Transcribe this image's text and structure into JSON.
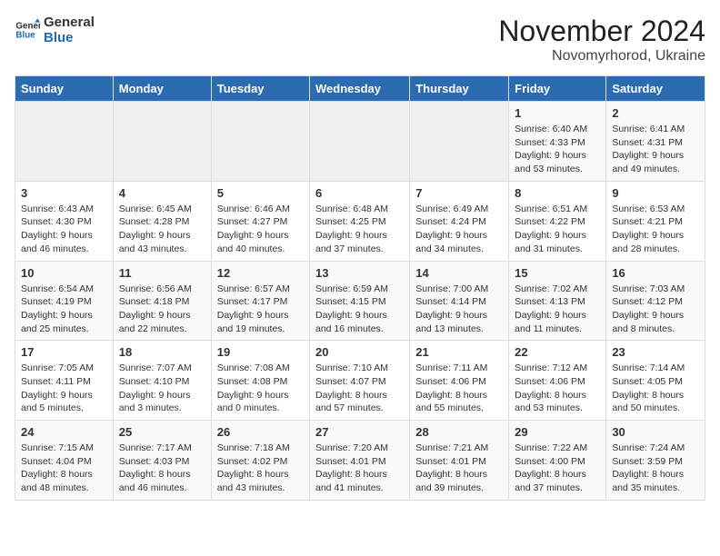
{
  "logo": {
    "line1": "General",
    "line2": "Blue"
  },
  "title": "November 2024",
  "location": "Novomyrhorod, Ukraine",
  "days_header": [
    "Sunday",
    "Monday",
    "Tuesday",
    "Wednesday",
    "Thursday",
    "Friday",
    "Saturday"
  ],
  "weeks": [
    [
      {
        "day": "",
        "info": ""
      },
      {
        "day": "",
        "info": ""
      },
      {
        "day": "",
        "info": ""
      },
      {
        "day": "",
        "info": ""
      },
      {
        "day": "",
        "info": ""
      },
      {
        "day": "1",
        "info": "Sunrise: 6:40 AM\nSunset: 4:33 PM\nDaylight: 9 hours and 53 minutes."
      },
      {
        "day": "2",
        "info": "Sunrise: 6:41 AM\nSunset: 4:31 PM\nDaylight: 9 hours and 49 minutes."
      }
    ],
    [
      {
        "day": "3",
        "info": "Sunrise: 6:43 AM\nSunset: 4:30 PM\nDaylight: 9 hours and 46 minutes."
      },
      {
        "day": "4",
        "info": "Sunrise: 6:45 AM\nSunset: 4:28 PM\nDaylight: 9 hours and 43 minutes."
      },
      {
        "day": "5",
        "info": "Sunrise: 6:46 AM\nSunset: 4:27 PM\nDaylight: 9 hours and 40 minutes."
      },
      {
        "day": "6",
        "info": "Sunrise: 6:48 AM\nSunset: 4:25 PM\nDaylight: 9 hours and 37 minutes."
      },
      {
        "day": "7",
        "info": "Sunrise: 6:49 AM\nSunset: 4:24 PM\nDaylight: 9 hours and 34 minutes."
      },
      {
        "day": "8",
        "info": "Sunrise: 6:51 AM\nSunset: 4:22 PM\nDaylight: 9 hours and 31 minutes."
      },
      {
        "day": "9",
        "info": "Sunrise: 6:53 AM\nSunset: 4:21 PM\nDaylight: 9 hours and 28 minutes."
      }
    ],
    [
      {
        "day": "10",
        "info": "Sunrise: 6:54 AM\nSunset: 4:19 PM\nDaylight: 9 hours and 25 minutes."
      },
      {
        "day": "11",
        "info": "Sunrise: 6:56 AM\nSunset: 4:18 PM\nDaylight: 9 hours and 22 minutes."
      },
      {
        "day": "12",
        "info": "Sunrise: 6:57 AM\nSunset: 4:17 PM\nDaylight: 9 hours and 19 minutes."
      },
      {
        "day": "13",
        "info": "Sunrise: 6:59 AM\nSunset: 4:15 PM\nDaylight: 9 hours and 16 minutes."
      },
      {
        "day": "14",
        "info": "Sunrise: 7:00 AM\nSunset: 4:14 PM\nDaylight: 9 hours and 13 minutes."
      },
      {
        "day": "15",
        "info": "Sunrise: 7:02 AM\nSunset: 4:13 PM\nDaylight: 9 hours and 11 minutes."
      },
      {
        "day": "16",
        "info": "Sunrise: 7:03 AM\nSunset: 4:12 PM\nDaylight: 9 hours and 8 minutes."
      }
    ],
    [
      {
        "day": "17",
        "info": "Sunrise: 7:05 AM\nSunset: 4:11 PM\nDaylight: 9 hours and 5 minutes."
      },
      {
        "day": "18",
        "info": "Sunrise: 7:07 AM\nSunset: 4:10 PM\nDaylight: 9 hours and 3 minutes."
      },
      {
        "day": "19",
        "info": "Sunrise: 7:08 AM\nSunset: 4:08 PM\nDaylight: 9 hours and 0 minutes."
      },
      {
        "day": "20",
        "info": "Sunrise: 7:10 AM\nSunset: 4:07 PM\nDaylight: 8 hours and 57 minutes."
      },
      {
        "day": "21",
        "info": "Sunrise: 7:11 AM\nSunset: 4:06 PM\nDaylight: 8 hours and 55 minutes."
      },
      {
        "day": "22",
        "info": "Sunrise: 7:12 AM\nSunset: 4:06 PM\nDaylight: 8 hours and 53 minutes."
      },
      {
        "day": "23",
        "info": "Sunrise: 7:14 AM\nSunset: 4:05 PM\nDaylight: 8 hours and 50 minutes."
      }
    ],
    [
      {
        "day": "24",
        "info": "Sunrise: 7:15 AM\nSunset: 4:04 PM\nDaylight: 8 hours and 48 minutes."
      },
      {
        "day": "25",
        "info": "Sunrise: 7:17 AM\nSunset: 4:03 PM\nDaylight: 8 hours and 46 minutes."
      },
      {
        "day": "26",
        "info": "Sunrise: 7:18 AM\nSunset: 4:02 PM\nDaylight: 8 hours and 43 minutes."
      },
      {
        "day": "27",
        "info": "Sunrise: 7:20 AM\nSunset: 4:01 PM\nDaylight: 8 hours and 41 minutes."
      },
      {
        "day": "28",
        "info": "Sunrise: 7:21 AM\nSunset: 4:01 PM\nDaylight: 8 hours and 39 minutes."
      },
      {
        "day": "29",
        "info": "Sunrise: 7:22 AM\nSunset: 4:00 PM\nDaylight: 8 hours and 37 minutes."
      },
      {
        "day": "30",
        "info": "Sunrise: 7:24 AM\nSunset: 3:59 PM\nDaylight: 8 hours and 35 minutes."
      }
    ]
  ]
}
